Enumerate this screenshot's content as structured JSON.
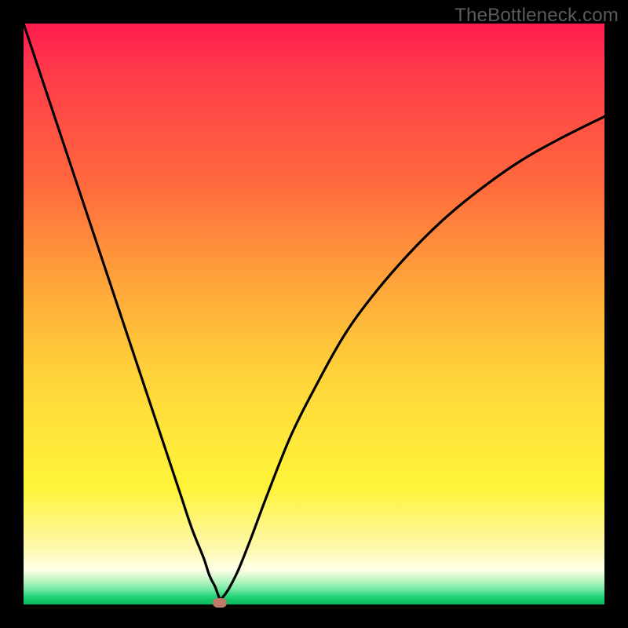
{
  "watermark": "TheBottleneck.com",
  "marker": {
    "x_frac": 0.338,
    "y_frac": 0.997
  },
  "chart_data": {
    "type": "line",
    "title": "",
    "xlabel": "",
    "ylabel": "",
    "xlim": [
      0,
      100
    ],
    "ylim": [
      0,
      100
    ],
    "series": [
      {
        "name": "bottleneck-curve",
        "x": [
          0,
          4,
          8,
          12,
          16,
          20,
          24,
          27,
          29,
          31,
          32,
          33,
          33.8,
          34.5,
          35.5,
          37,
          39,
          42,
          46,
          50,
          55,
          60,
          66,
          72,
          78,
          85,
          92,
          100
        ],
        "y": [
          100,
          88,
          76,
          64,
          52,
          40,
          28,
          19,
          13,
          8,
          5,
          3,
          1,
          1.5,
          3,
          6,
          11,
          19,
          29,
          37,
          46,
          53,
          60,
          66,
          71,
          76,
          80,
          84
        ]
      }
    ],
    "gradient_stops": [
      {
        "pos": 0.0,
        "color": "#ff1c4f"
      },
      {
        "pos": 0.45,
        "color": "#ffa63a"
      },
      {
        "pos": 0.8,
        "color": "#fff43a"
      },
      {
        "pos": 1.0,
        "color": "#0ab95a"
      }
    ],
    "annotations": [
      {
        "name": "optimum-marker",
        "x": 33.8,
        "y": 0.3,
        "color": "#c07a6a"
      }
    ]
  }
}
